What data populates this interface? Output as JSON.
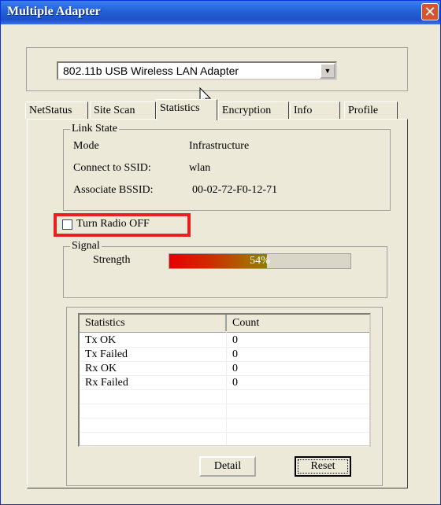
{
  "window": {
    "title": "Multiple Adapter",
    "close_glyph": "✕"
  },
  "adapter": {
    "selected": "802.11b USB Wireless LAN Adapter",
    "dropdown_glyph": "▼"
  },
  "tabs": [
    {
      "label": "NetStatus",
      "active": false
    },
    {
      "label": "Site Scan",
      "active": false
    },
    {
      "label": "Statistics",
      "active": true
    },
    {
      "label": "Encryption",
      "active": false
    },
    {
      "label": "Info",
      "active": false
    },
    {
      "label": "Profile",
      "active": false
    }
  ],
  "link_state": {
    "legend": "Link State",
    "mode_label": "Mode",
    "mode_value": "Infrastructure",
    "ssid_label": "Connect to SSID:",
    "ssid_value": "wlan",
    "bssid_label": "Associate BSSID:",
    "bssid_value": "00-02-72-F0-12-71"
  },
  "radio": {
    "label": "Turn Radio OFF",
    "checked": false
  },
  "signal": {
    "legend": "Signal",
    "strength_label": "Strength",
    "strength_percent": 54,
    "strength_text": "54%"
  },
  "stats": {
    "headers": [
      "Statistics",
      "Count"
    ],
    "rows": [
      [
        "Tx OK",
        "0"
      ],
      [
        "Tx Failed",
        "0"
      ],
      [
        "Rx OK",
        "0"
      ],
      [
        "Rx Failed",
        "0"
      ]
    ],
    "empty_rows": 4
  },
  "buttons": {
    "detail": "Detail",
    "reset": "Reset"
  },
  "icons": {
    "close": "close-icon",
    "dropdown": "chevron-down-icon",
    "cursor": "mouse-pointer-icon"
  },
  "colors": {
    "titlebar": "#2563d8",
    "highlight_box": "#e82020",
    "signal_start": "#e80000",
    "signal_end": "#8a8000"
  }
}
